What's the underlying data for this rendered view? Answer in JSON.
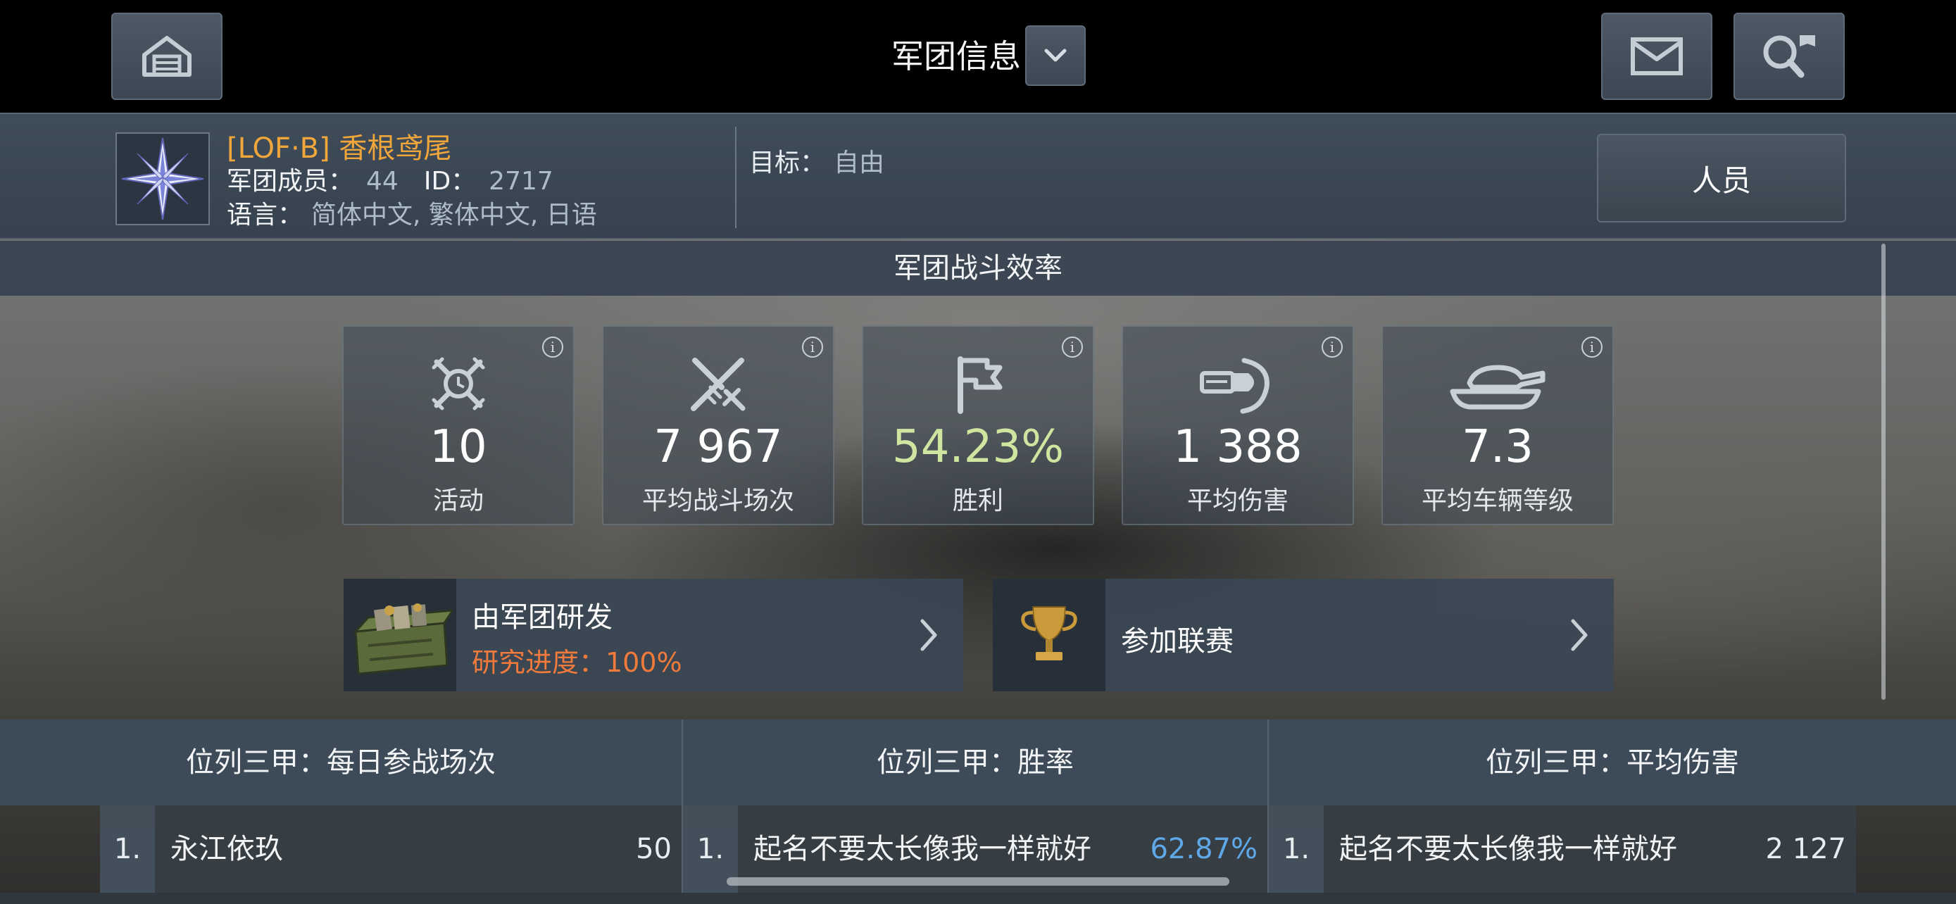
{
  "header": {
    "title": "军团信息"
  },
  "clan": {
    "name": "[LOF·B] 香根鸢尾",
    "members_label": "军团成员：",
    "members_value": "44",
    "id_label": "ID：",
    "id_value": "2717",
    "language_label": "语言：",
    "language_value": "简体中文, 繁体中文, 日语",
    "goal_label": "目标：",
    "goal_value": "自由",
    "staff_button": "人员"
  },
  "efficiency": {
    "title": "军团战斗效率",
    "stats": [
      {
        "icon": "activity-icon",
        "value": "10",
        "label": "活动"
      },
      {
        "icon": "crossed-swords-icon",
        "value": "7 967",
        "label": "平均战斗场次"
      },
      {
        "icon": "flag-icon",
        "value": "54.23%",
        "label": "胜利",
        "color": "#cfe6a0"
      },
      {
        "icon": "shell-damage-icon",
        "value": "1 388",
        "label": "平均伤害"
      },
      {
        "icon": "tank-icon",
        "value": "7.3",
        "label": "平均车辆等级"
      }
    ]
  },
  "research_card": {
    "title": "由军团研发",
    "progress_text": "研究进度：100%",
    "progress": 1.0,
    "icon": "equipment-crate-icon"
  },
  "league_card": {
    "title": "参加联赛",
    "icon": "trophy-icon"
  },
  "leaderboards": [
    {
      "header": "位列三甲：每日参战场次",
      "rank": "1.",
      "name": "永江依玖",
      "score": "50",
      "score_color": "#e8edf2"
    },
    {
      "header": "位列三甲：胜率",
      "rank": "1.",
      "name": "起名不要太长像我一样就好",
      "score": "62.87%",
      "score_color": "#5fa8e8"
    },
    {
      "header": "位列三甲：平均伤害",
      "rank": "1.",
      "name": "起名不要太长像我一样就好",
      "score": "2 127",
      "score_color": "#e8edf2"
    }
  ],
  "colors": {
    "clan_name": "#f0a63a",
    "research_progress": "#f07a3c",
    "win_rate": "#cfe6a0"
  }
}
